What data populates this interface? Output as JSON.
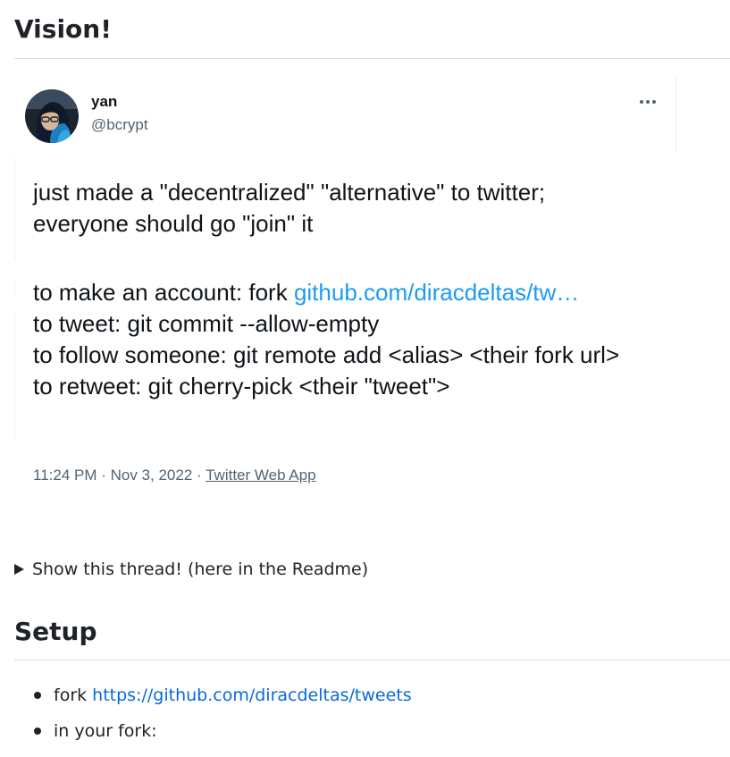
{
  "readme": {
    "vision_heading": "Vision!",
    "details_summary": "Show this thread! (here in the Readme)",
    "setup_heading": "Setup",
    "setup_items": [
      {
        "prefix": "fork ",
        "link": "https://github.com/diracdeltas/tweets"
      },
      {
        "text": "in your fork:"
      }
    ]
  },
  "tweet": {
    "author_name": "yan",
    "author_handle": "@bcrypt",
    "more_icon": "ellipsis-icon",
    "line1": "just made a \"decentralized\" \"alternative\" to twitter;",
    "line2": "everyone should go \"join\" it",
    "account_prefix": "to make an account: fork ",
    "account_link": "github.com/diracdeltas/tw…",
    "line_tweet": "to tweet: git commit --allow-empty",
    "line_follow": "to follow someone: git remote add <alias> <their fork url>",
    "line_retweet": "to retweet: git cherry-pick <their \"tweet\">",
    "timestamp": "11:24 PM · Nov 3, 2022 · ",
    "source": "Twitter Web App"
  },
  "colors": {
    "link_twitter": "#1d9bf0",
    "link_github": "#0969da",
    "text_muted": "#536471"
  }
}
